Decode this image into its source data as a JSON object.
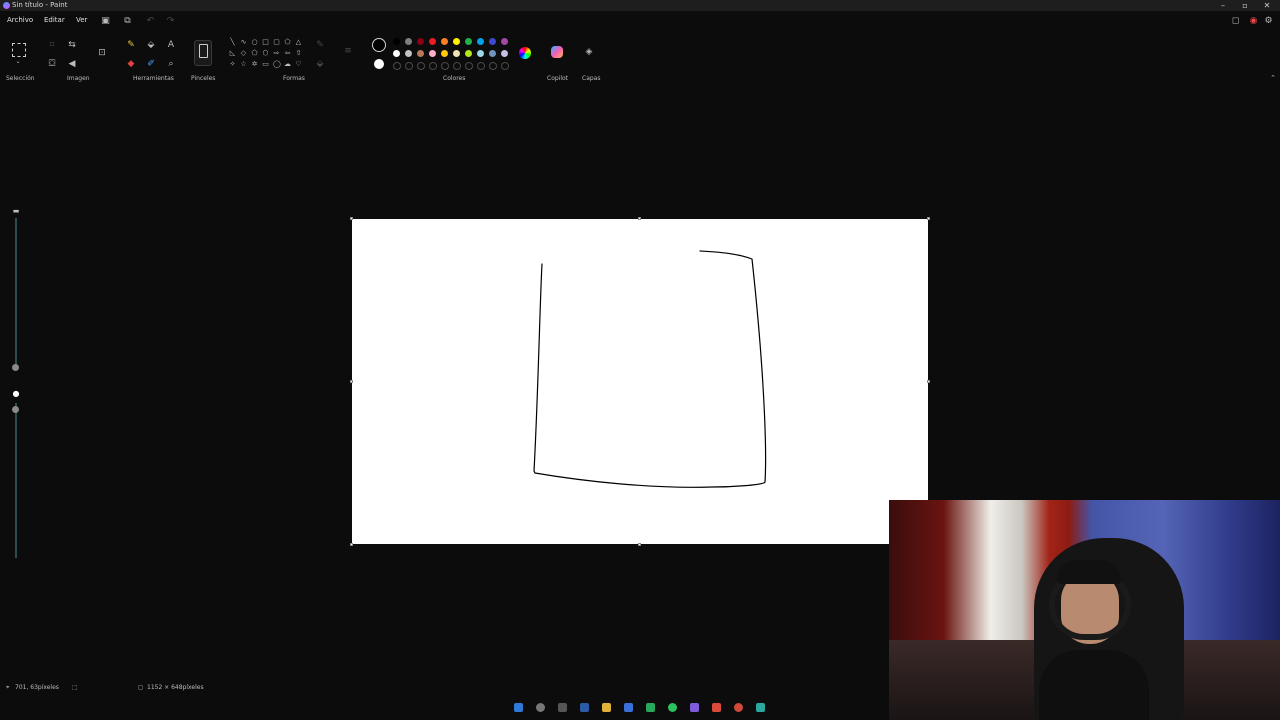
{
  "window": {
    "title": "Sin título - Paint"
  },
  "menu": {
    "file": "Archivo",
    "edit": "Editar",
    "view": "Ver"
  },
  "ribbon": {
    "groups": {
      "selection": "Selección",
      "image": "Imagen",
      "tools": "Herramientas",
      "brushes": "Pinceles",
      "shapes": "Formas",
      "colors": "Colores",
      "copilot": "Copilot",
      "layers": "Capas"
    },
    "colors": {
      "primary": "#000000",
      "secondary": "#ffffff",
      "palette_row1": [
        "#000000",
        "#7f7f7f",
        "#880015",
        "#ed1c24",
        "#ff7f27",
        "#fff200",
        "#22b14c",
        "#00a2e8",
        "#3f48cc",
        "#a349a4"
      ],
      "palette_row2": [
        "#ffffff",
        "#c3c3c3",
        "#b97a57",
        "#ffaec9",
        "#ffc90e",
        "#efe4b0",
        "#b5e61d",
        "#99d9ea",
        "#7092be",
        "#c8bfe7"
      ]
    }
  },
  "status": {
    "cursor_position": "701, 63píxeles",
    "canvas_size": "1152 × 648píxeles"
  },
  "canvas": {
    "background": "#ffffff",
    "stroke_color": "#000000"
  }
}
